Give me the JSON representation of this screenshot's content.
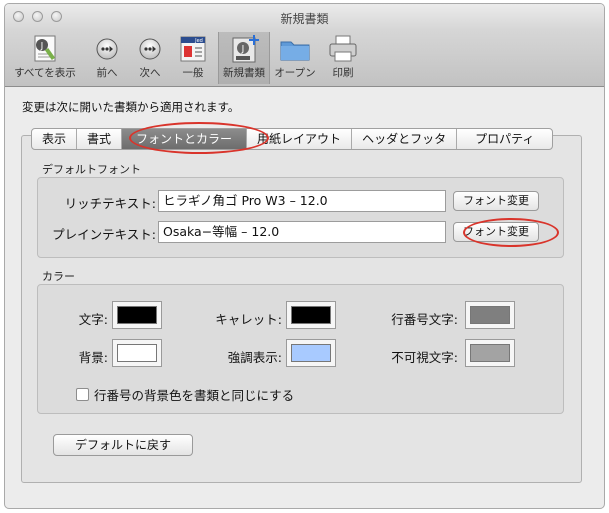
{
  "window": {
    "title": "新規書類"
  },
  "toolbar": {
    "items": [
      {
        "label": "すべてを表示"
      },
      {
        "label": "前へ"
      },
      {
        "label": "次へ"
      },
      {
        "label": "一般"
      },
      {
        "label": "新規書類"
      },
      {
        "label": "オープン"
      },
      {
        "label": "印刷"
      }
    ]
  },
  "description": "変更は次に開いた書類から適用されます。",
  "tabs": [
    {
      "label": "表示"
    },
    {
      "label": "書式"
    },
    {
      "label": "フォントとカラー"
    },
    {
      "label": "用紙レイアウト"
    },
    {
      "label": "ヘッダとフッタ"
    },
    {
      "label": "プロパティ"
    }
  ],
  "font_section": {
    "title": "デフォルトフォント",
    "rich_label": "リッチテキスト:",
    "rich_value": "ヒラギノ角ゴ Pro W3 – 12.0",
    "plain_label": "プレインテキスト:",
    "plain_value": "Osaka−等幅 – 12.0",
    "change_button": "フォント変更"
  },
  "color_section": {
    "title": "カラー",
    "text_label": "文字:",
    "background_label": "背景:",
    "caret_label": "キャレット:",
    "highlight_label": "強調表示:",
    "line_number_label": "行番号文字:",
    "invisible_label": "不可視文字:",
    "colors": {
      "text": "#000000",
      "background": "#ffffff",
      "caret": "#000000",
      "highlight": "#a8caff",
      "line_number": "#7f7f7f",
      "invisible": "#a3a3a3"
    },
    "checkbox_label": "行番号の背景色を書類と同じにする",
    "checkbox_checked": false
  },
  "reset_button": "デフォルトに戻す",
  "annotation_color": "#d9342b"
}
